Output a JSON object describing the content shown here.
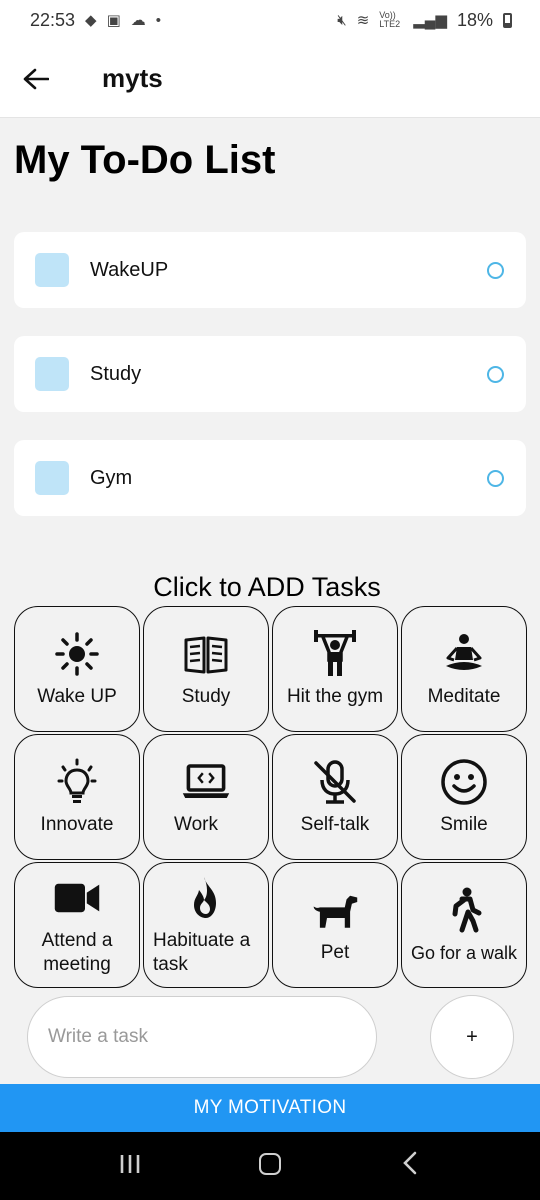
{
  "status_bar": {
    "time": "22:53",
    "battery": "18%",
    "left_icons": [
      "game-controller-icon",
      "outlook-icon",
      "cloud-icon",
      "dot-icon"
    ],
    "right_icons": [
      "mute-icon",
      "wifi-icon",
      "volte-icon",
      "signal-icon"
    ],
    "volte_label": "Vo)) LTE2"
  },
  "app_bar": {
    "title": "myts",
    "back_icon": "arrow-left-icon"
  },
  "heading": "My To-Do List",
  "todos": [
    {
      "label": "WakeUP"
    },
    {
      "label": "Study"
    },
    {
      "label": "Gym"
    }
  ],
  "add_heading": "Click to ADD Tasks",
  "tasks": [
    {
      "label": "Wake UP",
      "icon": "sun-icon"
    },
    {
      "label": "Study",
      "icon": "book-icon"
    },
    {
      "label": "Hit the gym",
      "icon": "weightlifter-icon"
    },
    {
      "label": "Meditate",
      "icon": "meditation-icon"
    },
    {
      "label": "Innovate",
      "icon": "lightbulb-icon"
    },
    {
      "label": "Work",
      "icon": "laptop-code-icon"
    },
    {
      "label": "Self-talk",
      "icon": "mic-off-icon"
    },
    {
      "label": "Smile",
      "icon": "smiley-icon"
    },
    {
      "label": "Attend a meeting",
      "icon": "video-camera-icon"
    },
    {
      "label": "Habituate a task",
      "icon": "fire-icon"
    },
    {
      "label": "Pet",
      "icon": "dog-icon"
    },
    {
      "label": "Go for a walk",
      "icon": "walking-person-icon"
    }
  ],
  "task_input": {
    "placeholder": "Write a task",
    "value": ""
  },
  "add_button": "+",
  "motivation_button": "MY MOTIVATION",
  "nav": {
    "recents_icon": "recents-icon",
    "home_icon": "home-icon",
    "back_icon": "back-icon"
  },
  "colors": {
    "primary": "#2196f3",
    "checkbox": "#bfe4f8",
    "circle": "#4eb6e6",
    "background": "#f2f2f2"
  }
}
